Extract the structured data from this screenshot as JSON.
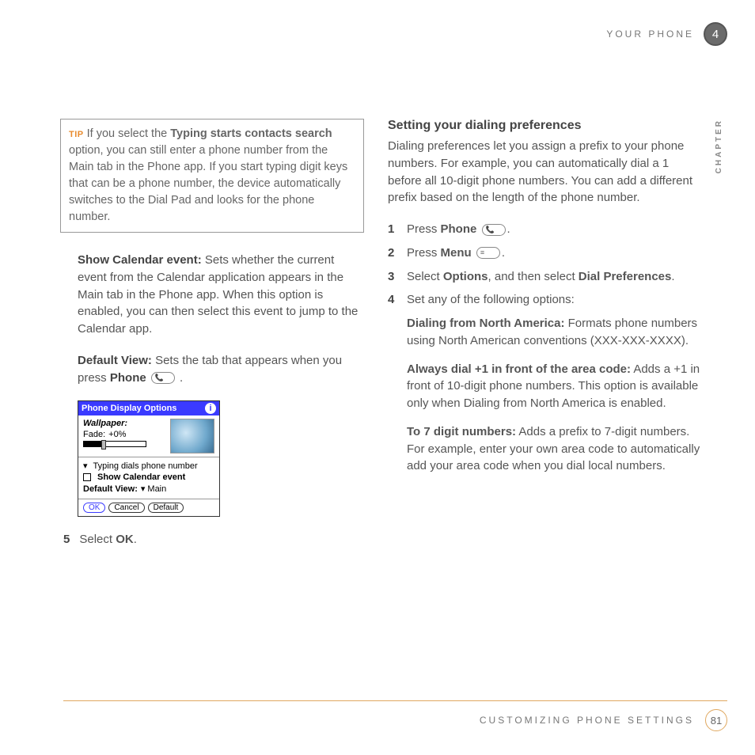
{
  "header": {
    "section": "YOUR PHONE",
    "chapter_number": "4",
    "chapter_label": "CHAPTER"
  },
  "tip": {
    "label": "TIP",
    "text_before": " If you select the ",
    "bold": "Typing starts contacts search",
    "text_after": " option, you can still enter a phone number from the Main tab in the Phone app. If you start typing digit keys that can be a phone number, the device automatically switches to the Dial Pad and looks for the phone number."
  },
  "left": {
    "p1_bold": "Show Calendar event:",
    "p1_rest": " Sets whether the current event from the Calendar application appears in the Main tab in the Phone app. When this option is enabled, you can then select this event to jump to the Calendar app.",
    "p2_bold": "Default View:",
    "p2_rest": " Sets the tab that appears when you press ",
    "p2_bold2": "Phone",
    "p2_after": " .",
    "step5_num": "5",
    "step5_a": "Select ",
    "step5_b": "OK",
    "step5_c": "."
  },
  "palm": {
    "title": "Phone Display Options",
    "wallpaper_label": "Wallpaper:",
    "fade_label": "Fade:",
    "fade_value": "+0%",
    "typing": "Typing dials phone number",
    "show_cal": "Show Calendar event",
    "default_view_label": "Default View:",
    "default_view_value": "Main",
    "ok": "OK",
    "cancel": "Cancel",
    "default": "Default"
  },
  "right": {
    "heading": "Setting your dialing preferences",
    "intro": "Dialing preferences let you assign a prefix to your phone numbers. For example, you can automatically dial a 1 before all 10-digit phone numbers. You can add a different prefix based on the length of the phone number.",
    "s1_num": "1",
    "s1_a": "Press ",
    "s1_b": "Phone",
    "s1_c": ".",
    "s2_num": "2",
    "s2_a": "Press ",
    "s2_b": "Menu",
    "s2_c": ".",
    "s3_num": "3",
    "s3_a": "Select ",
    "s3_b": "Options",
    "s3_c": ", and then select ",
    "s3_d": "Dial Preferences",
    "s3_e": ".",
    "s4_num": "4",
    "s4_a": "Set any of the following options:",
    "opt1_b": "Dialing from North America:",
    "opt1_t": " Formats phone numbers using North American conventions (XXX-XXX-XXXX).",
    "opt2_b": "Always dial +1 in front of the area code:",
    "opt2_t": " Adds a +1 in front of 10-digit phone numbers. This option is available only when Dialing from North America is enabled.",
    "opt3_b": "To 7 digit numbers:",
    "opt3_t": " Adds a prefix to 7-digit numbers. For example, enter your own area code to automatically add your area code when you dial local numbers."
  },
  "footer": {
    "title": "CUSTOMIZING PHONE SETTINGS",
    "page": "81"
  },
  "icons": {
    "phone_key": "📞",
    "menu_key": "≡"
  }
}
